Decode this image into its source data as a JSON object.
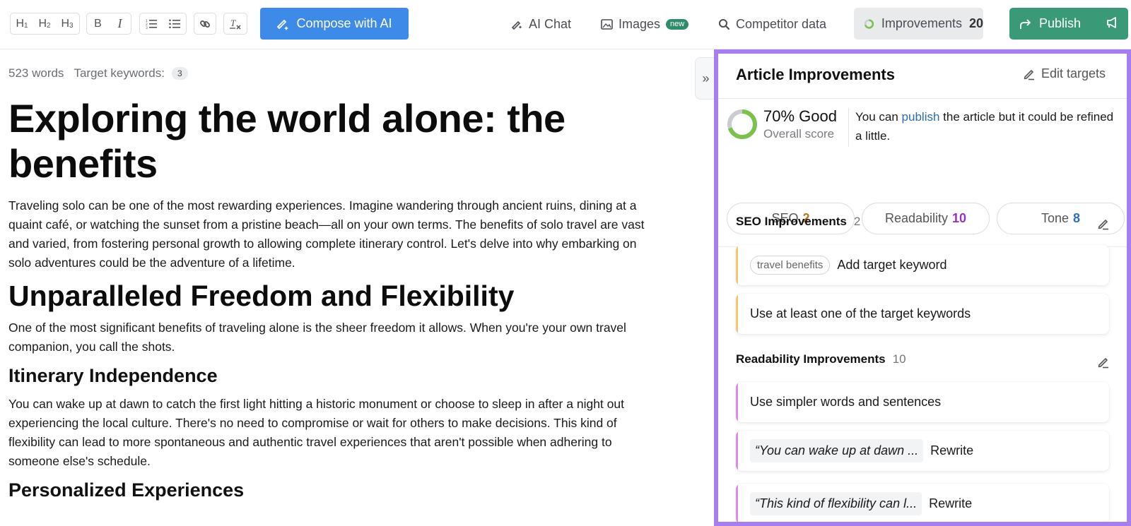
{
  "toolbar": {
    "headings": [
      "H",
      "H",
      "H"
    ],
    "heading_subs": [
      "1",
      "2",
      "3"
    ],
    "bold": "B",
    "italic": "I",
    "compose_label": "Compose with AI",
    "nav": {
      "ai_chat": "AI Chat",
      "images": "Images",
      "images_badge": "new",
      "competitor": "Competitor data"
    },
    "improvements_label": "Improvements",
    "improvements_count": "20",
    "publish_label": "Publish"
  },
  "editor": {
    "word_count": "523 words",
    "target_keywords_label": "Target keywords:",
    "target_keywords_count": "3",
    "title": "Exploring the world alone: the benefits",
    "intro": "Traveling solo can be one of the most rewarding experiences. Imagine wandering through ancient ruins, dining at a quaint café, or watching the sunset from a pristine beach—all on your own terms. The benefits of solo travel are vast and varied, from fostering personal growth to allowing complete itinerary control. Let's delve into why embarking on solo adventures could be the adventure of a lifetime.",
    "h2_1": "Unparalleled Freedom and Flexibility",
    "p2": "One of the most significant benefits of traveling alone is the sheer freedom it allows. When you're your own travel companion, you call the shots.",
    "h3_1": "Itinerary Independence",
    "p3": "You can wake up at dawn to catch the first light hitting a historic monument or choose to sleep in after a night out experiencing the local culture. There's no need to compromise or wait for others to make decisions. This kind of flexibility can lead to more spontaneous and authentic travel experiences that aren't possible when adhering to someone else's schedule.",
    "h3_2": "Personalized Experiences"
  },
  "panel": {
    "title": "Article Improvements",
    "edit_targets": "Edit targets",
    "score": {
      "percent": 70,
      "value_label": "70% Good",
      "sub_label": "Overall score",
      "msg_pre": "You can ",
      "msg_link": "publish",
      "msg_post": " the article but it could be refined a little.",
      "ring_color": "#7cc04e",
      "ring_track": "#c9ccd1"
    },
    "categories": [
      {
        "label": "SEO",
        "count": "2",
        "color": "#b7761f"
      },
      {
        "label": "Readability",
        "count": "10",
        "color": "#9b2fc0"
      },
      {
        "label": "Tone",
        "count": "8",
        "color": "#2e6fb8"
      }
    ],
    "seo_section": {
      "title": "SEO Improvements",
      "count": "2",
      "accent": "#f0c870",
      "items": [
        {
          "chip": "travel benefits",
          "text": "Add target keyword"
        },
        {
          "text": "Use at least one of the target keywords"
        }
      ]
    },
    "readability_section": {
      "title": "Readability Improvements",
      "count": "10",
      "accent": "#dc8ce6",
      "items": [
        {
          "text": "Use simpler words and sentences"
        },
        {
          "quote": "“You can wake up at dawn ...",
          "action": "Rewrite"
        },
        {
          "quote": "“This kind of flexibility can l...",
          "action": "Rewrite"
        }
      ]
    }
  },
  "colors": {
    "compose_bg": "#3d8ae8",
    "publish_bg": "#3a9a77",
    "highlight_border": "#a77ef0"
  }
}
